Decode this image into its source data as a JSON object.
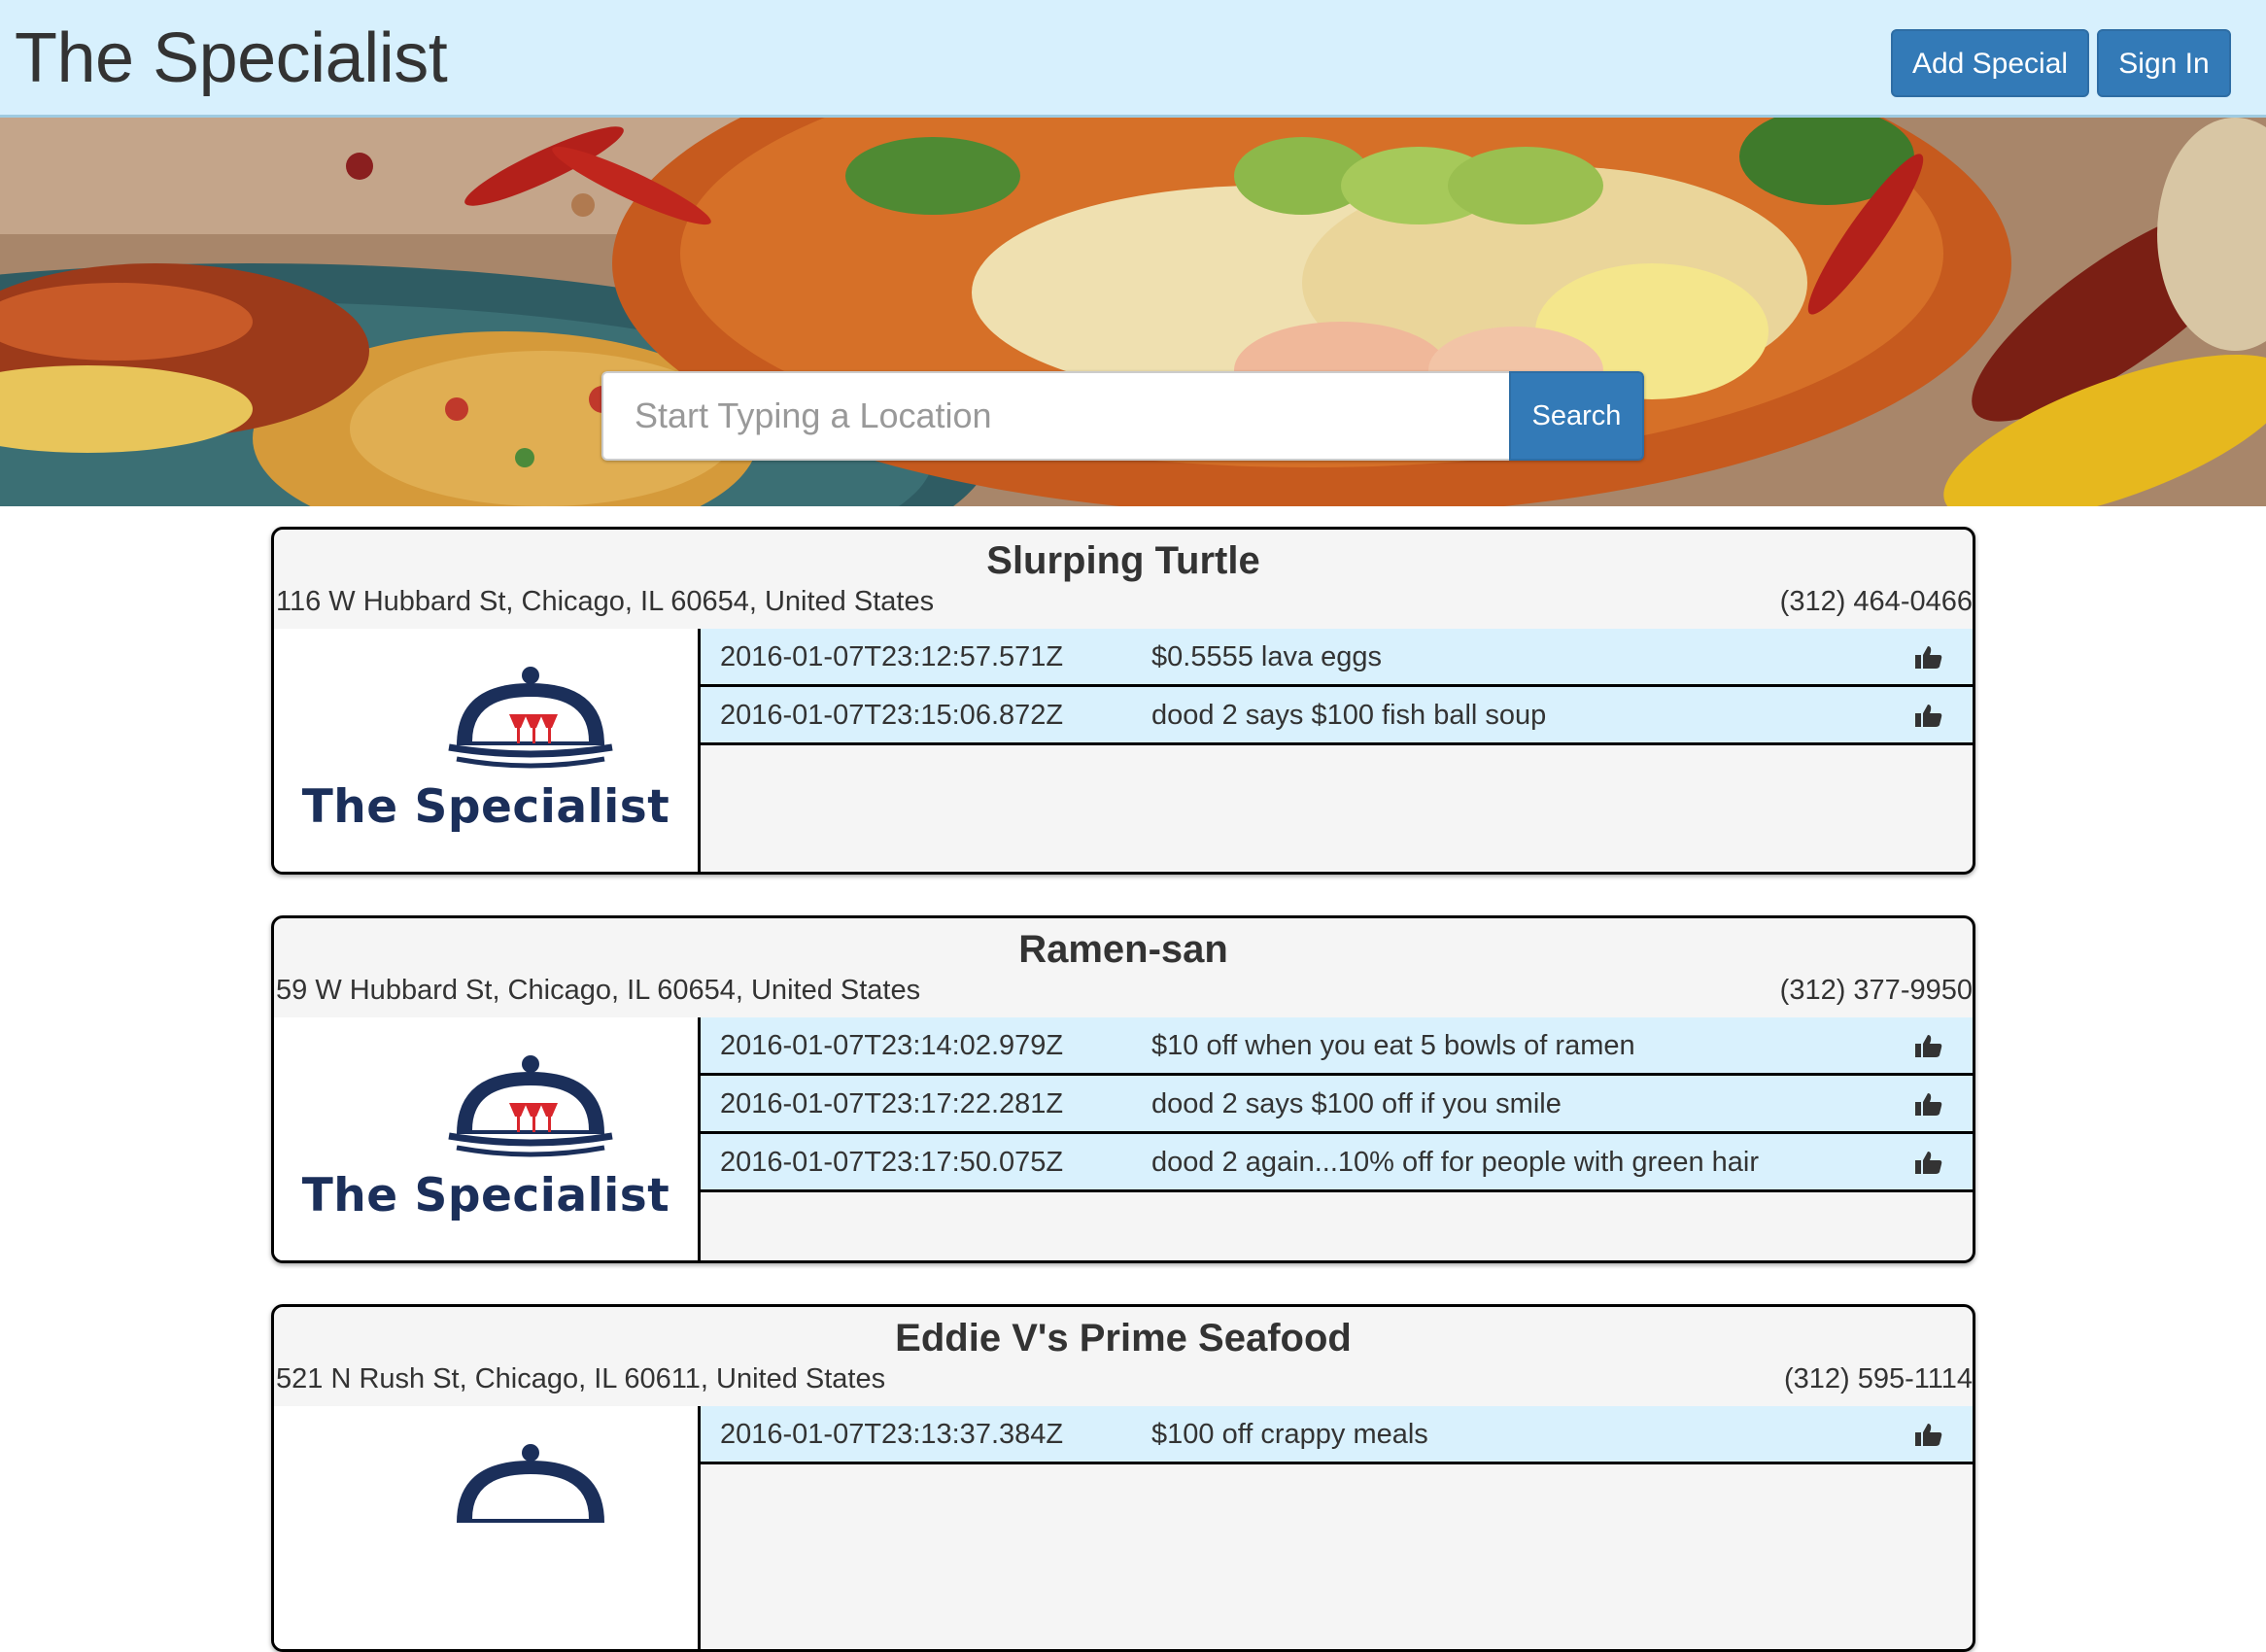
{
  "navbar": {
    "brand": "The Specialist",
    "add_special_label": "Add Special",
    "sign_in_label": "Sign In"
  },
  "hero": {
    "image": "mexican-food-banner",
    "search": {
      "placeholder": "Start Typing a Location",
      "value": "",
      "button_label": "Search"
    }
  },
  "colors": {
    "navbar_bg": "#d7f0fd",
    "primary_button": "#337ab7",
    "special_row_bg": "#d9f1fd",
    "card_bg": "#f5f5f5",
    "logo_navy": "#1b2f5a",
    "logo_red": "#d9262c"
  },
  "logo": {
    "text": "The Specialist",
    "icon": "serving-cloche-icon"
  },
  "restaurants": [
    {
      "name": "Slurping Turtle",
      "address": "116 W Hubbard St, Chicago, IL 60654, United States",
      "phone": "(312) 464-0466",
      "specials": [
        {
          "timestamp": "2016-01-07T23:12:57.571Z",
          "text": "$0.5555 lava eggs",
          "icon": "thumbs-up-icon"
        },
        {
          "timestamp": "2016-01-07T23:15:06.872Z",
          "text": "dood 2 says $100 fish ball soup",
          "icon": "thumbs-up-icon"
        }
      ]
    },
    {
      "name": "Ramen-san",
      "address": "59 W Hubbard St, Chicago, IL 60654, United States",
      "phone": "(312) 377-9950",
      "specials": [
        {
          "timestamp": "2016-01-07T23:14:02.979Z",
          "text": "$10 off when you eat 5 bowls of ramen",
          "icon": "thumbs-up-icon"
        },
        {
          "timestamp": "2016-01-07T23:17:22.281Z",
          "text": "dood 2 says $100 off if you smile",
          "icon": "thumbs-up-icon"
        },
        {
          "timestamp": "2016-01-07T23:17:50.075Z",
          "text": "dood 2 again...10% off for people with green hair",
          "icon": "thumbs-up-icon"
        }
      ]
    },
    {
      "name": "Eddie V's Prime Seafood",
      "address": "521 N Rush St, Chicago, IL 60611, United States",
      "phone": "(312) 595-1114",
      "specials": [
        {
          "timestamp": "2016-01-07T23:13:37.384Z",
          "text": "$100 off crappy meals",
          "icon": "thumbs-up-icon"
        }
      ]
    }
  ]
}
